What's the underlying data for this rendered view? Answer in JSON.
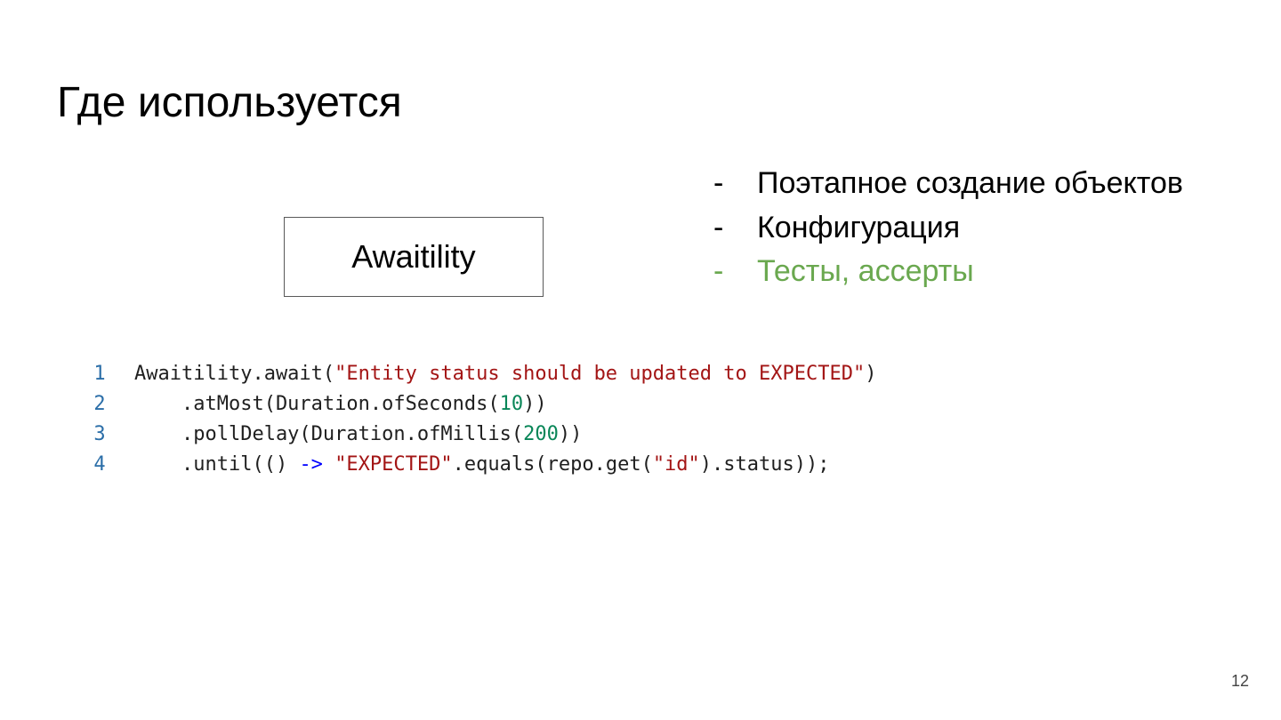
{
  "slide": {
    "title": "Где используется",
    "box_label": "Awaitility",
    "page_number": "12"
  },
  "bullets": [
    {
      "dash": "-",
      "text": "Поэтапное создание объектов",
      "color": "#000000"
    },
    {
      "dash": "-",
      "text": "Конфигурация",
      "color": "#000000"
    },
    {
      "dash": "-",
      "text": "Тесты, ассерты",
      "color": "#6aa84f"
    }
  ],
  "code": {
    "line_numbers": [
      "1",
      "2",
      "3",
      "4"
    ],
    "line1": {
      "a": "Awaitility.await(",
      "b": "\"Entity status should be updated to EXPECTED\"",
      "c": ")"
    },
    "line2": {
      "a": "    .atMost(Duration.ofSeconds(",
      "b": "10",
      "c": "))"
    },
    "line3": {
      "a": "    .pollDelay(Duration.ofMillis(",
      "b": "200",
      "c": "))"
    },
    "line4": {
      "a": "    .until(() ",
      "b": "->",
      "c": " ",
      "d": "\"EXPECTED\"",
      "e": ".equals(repo.get(",
      "f": "\"id\"",
      "g": ").status));"
    }
  },
  "colors": {
    "string": "#a31515",
    "number": "#098658",
    "operator": "#0000ff",
    "line_number": "#2b6ea8",
    "accent_green": "#6aa84f"
  }
}
